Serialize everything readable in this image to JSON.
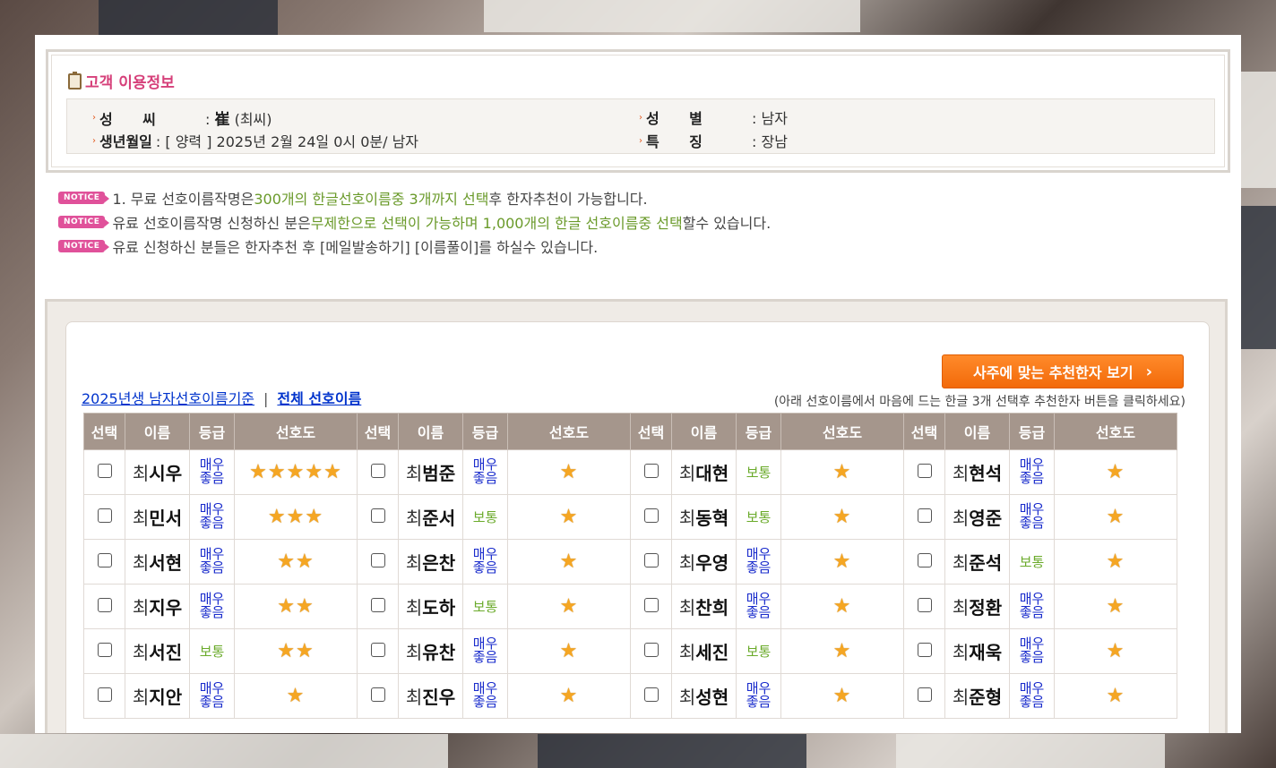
{
  "info": {
    "title": "고객 이용정보",
    "surname_label": "성      씨",
    "surname_value_hanja": "崔",
    "surname_value_hangul": "(최씨)",
    "gender_label": "성      별",
    "gender_value": ": 남자",
    "birth_label": "생년월일",
    "birth_value": ": [ 양력 ] 2025년 2월 24일 0시 0분/ 남자",
    "feature_label": "특      징",
    "feature_value": ": 장남"
  },
  "notices": {
    "badge": "NOTICE",
    "n1_a": "1. 무료 선호이름작명은 ",
    "n1_b": "300개의 한글선호이름중 3개까지 선택",
    "n1_c": "후 한자추천이 가능합니다.",
    "n2_a": "유료 선호이름작명 신청하신 분은",
    "n2_b": "무제한으로 선택이 가능하며 1,000개의 한글 선호이름중 선택",
    "n2_c": "할수 있습니다.",
    "n3": "유료 신청하신 분들은 한자추천 후 [메일발송하기] [이름풀이]를 하실수 있습니다."
  },
  "list": {
    "recommend_button": "사주에 맞는 추천한자 보기",
    "link_year": "2025년생 남자선호이름기준",
    "separator": "|",
    "link_all": "전체 선호이름",
    "hint": "(아래 선호이름에서 마음에 드는 한글 3개 선택후 추천한자 버튼을 클릭하세요)",
    "headers": [
      "선택",
      "이름",
      "등급",
      "선호도"
    ],
    "surname": "최",
    "grade_good_line1": "매우",
    "grade_good_line2": "좋음",
    "grade_normal": "보통",
    "star_glyph": "★",
    "rows": [
      [
        {
          "name": "시우",
          "grade": "good",
          "stars": 5
        },
        {
          "name": "범준",
          "grade": "good",
          "stars": 1
        },
        {
          "name": "대현",
          "grade": "normal",
          "stars": 1
        },
        {
          "name": "현석",
          "grade": "good",
          "stars": 1
        }
      ],
      [
        {
          "name": "민서",
          "grade": "good",
          "stars": 3
        },
        {
          "name": "준서",
          "grade": "normal",
          "stars": 1
        },
        {
          "name": "동혁",
          "grade": "normal",
          "stars": 1
        },
        {
          "name": "영준",
          "grade": "good",
          "stars": 1
        }
      ],
      [
        {
          "name": "서현",
          "grade": "good",
          "stars": 2
        },
        {
          "name": "은찬",
          "grade": "good",
          "stars": 1
        },
        {
          "name": "우영",
          "grade": "good",
          "stars": 1
        },
        {
          "name": "준석",
          "grade": "normal",
          "stars": 1
        }
      ],
      [
        {
          "name": "지우",
          "grade": "good",
          "stars": 2
        },
        {
          "name": "도하",
          "grade": "normal",
          "stars": 1
        },
        {
          "name": "찬희",
          "grade": "good",
          "stars": 1
        },
        {
          "name": "정환",
          "grade": "good",
          "stars": 1
        }
      ],
      [
        {
          "name": "서진",
          "grade": "normal",
          "stars": 2
        },
        {
          "name": "유찬",
          "grade": "good",
          "stars": 1
        },
        {
          "name": "세진",
          "grade": "normal",
          "stars": 1
        },
        {
          "name": "재욱",
          "grade": "good",
          "stars": 1
        }
      ],
      [
        {
          "name": "지안",
          "grade": "good",
          "stars": 1
        },
        {
          "name": "진우",
          "grade": "good",
          "stars": 1
        },
        {
          "name": "성현",
          "grade": "good",
          "stars": 1
        },
        {
          "name": "준형",
          "grade": "good",
          "stars": 1
        }
      ]
    ]
  }
}
